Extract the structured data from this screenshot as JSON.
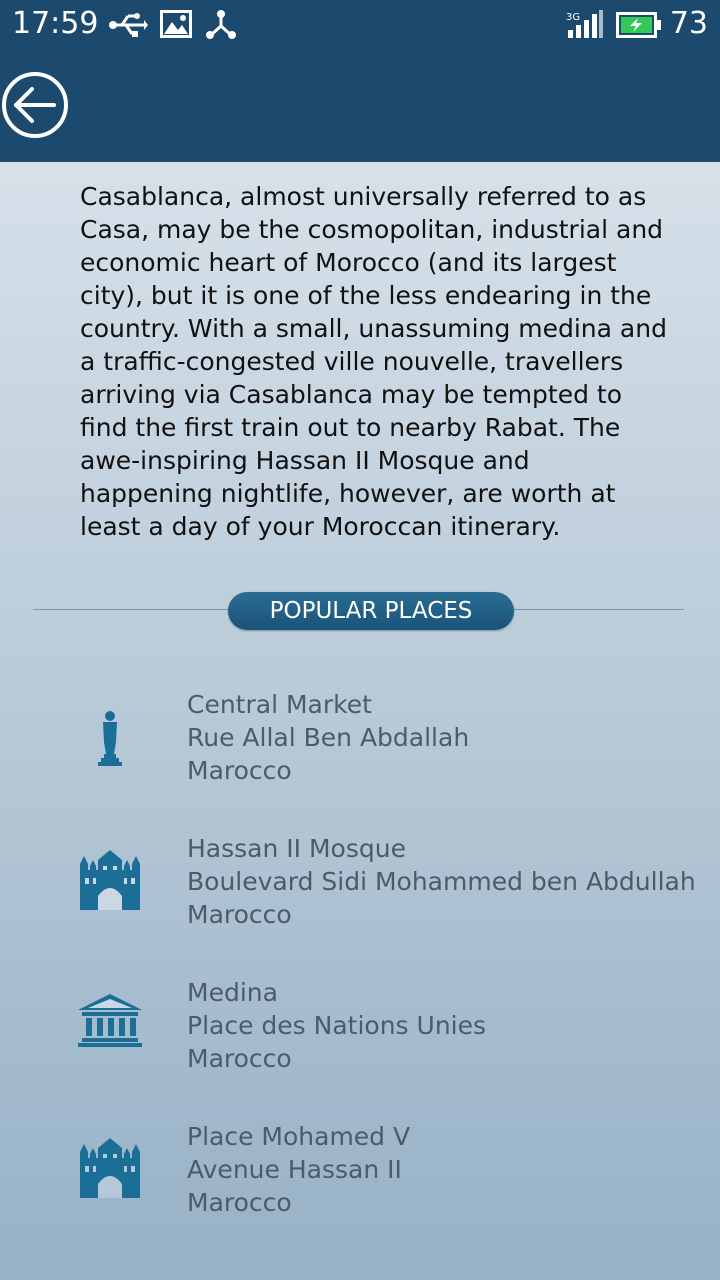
{
  "status_bar": {
    "time": "17:59",
    "battery_level": "73",
    "icons": [
      "usb-icon",
      "image-icon",
      "share-icon",
      "signal-3g-icon",
      "battery-charging-icon"
    ]
  },
  "app_bar": {
    "back_icon": "arrow-left-circle-icon"
  },
  "description": "Casablanca, almost universally referred to as Casa, may be the cosmopolitan, industrial and economic heart of Morocco (and its largest city), but it is one of the less endearing in the country. With a small, unassuming medina and a traffic-congested ville nouvelle, travellers arriving via Casablanca may be tempted to find the first train out to nearby Rabat. The awe-inspiring Hassan II Mosque and happening nightlife, however, are worth at least a day of your Moroccan itinerary.",
  "section": {
    "title": "POPULAR PLACES"
  },
  "places": [
    {
      "name": "Central Market",
      "address": "Rue Allal Ben Abdallah",
      "country": "Marocco",
      "icon": "statue-icon"
    },
    {
      "name": "Hassan II Mosque",
      "address": "Boulevard Sidi Mohammed ben Abdullah",
      "country": "Marocco",
      "icon": "mosque-icon"
    },
    {
      "name": "Medina",
      "address": "Place des Nations Unies",
      "country": "Marocco",
      "icon": "museum-icon"
    },
    {
      "name": "Place Mohamed V",
      "address": "Avenue Hassan II",
      "country": "Marocco",
      "icon": "mosque-icon"
    }
  ],
  "colors": {
    "header": "#1c4a6e",
    "accent": "#1b6f96",
    "text_secondary": "#4d5b67"
  }
}
